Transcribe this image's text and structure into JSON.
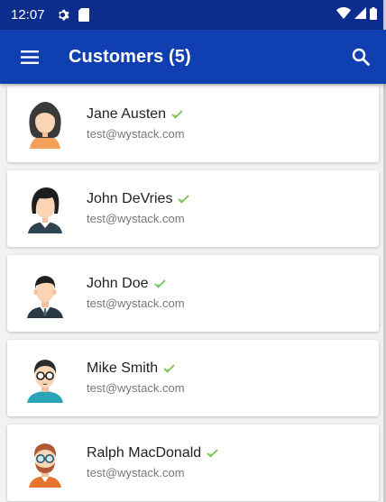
{
  "status_bar": {
    "time": "12:07",
    "icons_left": [
      "gear-icon",
      "sd-card-icon"
    ],
    "icons_right": [
      "wifi-icon",
      "signal-icon",
      "battery-icon"
    ]
  },
  "app_bar": {
    "menu_icon": "menu-icon",
    "title": "Customers (5)",
    "search_icon": "search-icon"
  },
  "colors": {
    "status_bar": "#0d2d8c",
    "app_bar": "#0f3fb0",
    "verified_check": "#6dc24b"
  },
  "customers": [
    {
      "name": "Jane Austen",
      "email": "test@wystack.com",
      "verified": true,
      "avatar": "female-dark-hair-avatar"
    },
    {
      "name": "John DeVries",
      "email": "test@wystack.com",
      "verified": true,
      "avatar": "female-bob-hair-avatar"
    },
    {
      "name": "John Doe",
      "email": "test@wystack.com",
      "verified": true,
      "avatar": "male-suit-avatar"
    },
    {
      "name": "Mike Smith",
      "email": "test@wystack.com",
      "verified": true,
      "avatar": "male-glasses-avatar"
    },
    {
      "name": "Ralph MacDonald",
      "email": "test@wystack.com",
      "verified": true,
      "avatar": "male-glasses-beard-avatar"
    }
  ]
}
